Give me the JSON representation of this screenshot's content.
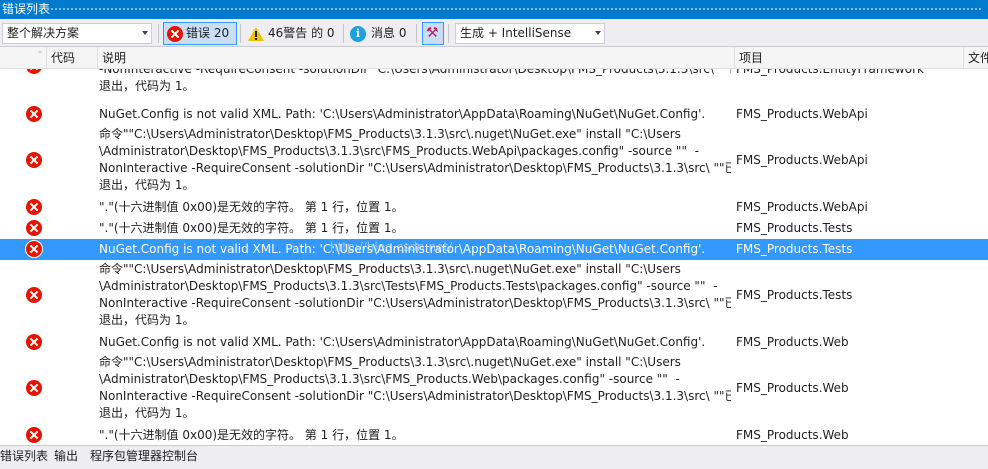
{
  "window": {
    "title": "错误列表"
  },
  "toolbar": {
    "scope_select": "整个解决方案",
    "errors_label": "错误 20",
    "warnings_label": "46警告 的 0",
    "messages_label": "消息 0",
    "source_select": "生成 + IntelliSense"
  },
  "columns": {
    "code": "代码",
    "description": "说明",
    "project": "项目",
    "file": "文件"
  },
  "rows": [
    {
      "lines": [
        "-NonInteractive -RequireConsent -solutionDir \"C:\\Users\\Administrator\\Desktop\\FMS_Products\\3.1.3\\src\\ \"\"已",
        "退出，代码为 1。"
      ],
      "project": "FMS_Products.EntityFramework"
    },
    {
      "lines": [
        "NuGet.Config is not valid XML. Path: 'C:\\Users\\Administrator\\AppData\\Roaming\\NuGet\\NuGet.Config'."
      ],
      "project": "FMS_Products.WebApi"
    },
    {
      "lines": [
        "命令\"\"C:\\Users\\Administrator\\Desktop\\FMS_Products\\3.1.3\\src\\.nuget\\NuGet.exe\" install \"C:\\Users",
        "\\Administrator\\Desktop\\FMS_Products\\3.1.3\\src\\FMS_Products.WebApi\\packages.config\" -source \"\"  -",
        "NonInteractive -RequireConsent -solutionDir \"C:\\Users\\Administrator\\Desktop\\FMS_Products\\3.1.3\\src\\ \"\"已",
        "退出，代码为 1。"
      ],
      "project": "FMS_Products.WebApi"
    },
    {
      "lines": [
        "\".\"(十六进制值 0x00)是无效的字符。 第 1 行，位置 1。"
      ],
      "project": "FMS_Products.WebApi"
    },
    {
      "lines": [
        "\".\"(十六进制值 0x00)是无效的字符。 第 1 行，位置 1。"
      ],
      "project": "FMS_Products.Tests"
    },
    {
      "lines": [
        "NuGet.Config is not valid XML. Path: 'C:\\Users\\Administrator\\AppData\\Roaming\\NuGet\\NuGet.Config'."
      ],
      "project": "FMS_Products.Tests",
      "selected": true,
      "watermark": "http://blog.csdn.net/"
    },
    {
      "lines": [
        "命令\"\"C:\\Users\\Administrator\\Desktop\\FMS_Products\\3.1.3\\src\\.nuget\\NuGet.exe\" install \"C:\\Users",
        "\\Administrator\\Desktop\\FMS_Products\\3.1.3\\src\\Tests\\FMS_Products.Tests\\packages.config\" -source \"\"  -",
        "NonInteractive -RequireConsent -solutionDir \"C:\\Users\\Administrator\\Desktop\\FMS_Products\\3.1.3\\src\\ \"\"已",
        "退出，代码为 1。"
      ],
      "project": "FMS_Products.Tests"
    },
    {
      "lines": [
        "NuGet.Config is not valid XML. Path: 'C:\\Users\\Administrator\\AppData\\Roaming\\NuGet\\NuGet.Config'."
      ],
      "project": "FMS_Products.Web"
    },
    {
      "lines": [
        "命令\"\"C:\\Users\\Administrator\\Desktop\\FMS_Products\\3.1.3\\src\\.nuget\\NuGet.exe\" install \"C:\\Users",
        "\\Administrator\\Desktop\\FMS_Products\\3.1.3\\src\\FMS_Products.Web\\packages.config\" -source \"\"  -",
        "NonInteractive -RequireConsent -solutionDir \"C:\\Users\\Administrator\\Desktop\\FMS_Products\\3.1.3\\src\\ \"\"已",
        "退出，代码为 1。"
      ],
      "project": "FMS_Products.Web"
    },
    {
      "lines": [
        "\".\"(十六进制值 0x00)是无效的字符。 第 1 行，位置 1。"
      ],
      "project": "FMS_Products.Web"
    }
  ],
  "bottom_tabs": [
    "错误列表",
    "输出",
    "程序包管理器控制台"
  ]
}
